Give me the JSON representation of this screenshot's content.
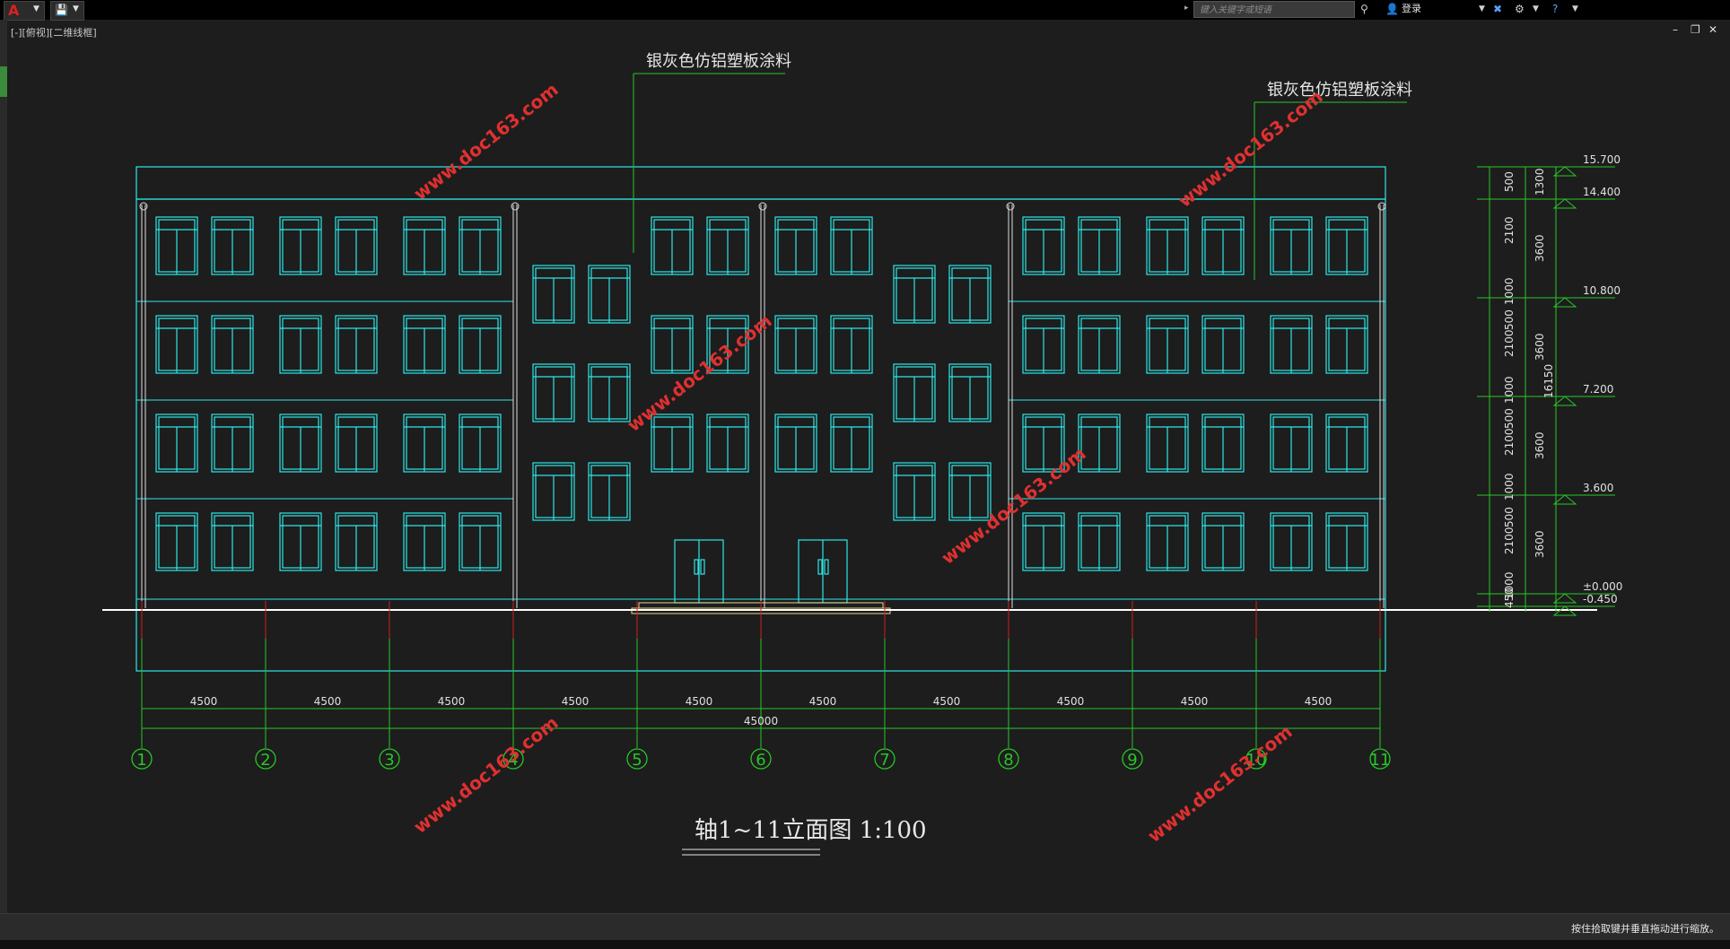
{
  "toolbar": {
    "app_menu_icon": "autocad-logo-icon",
    "search_placeholder": "键入关键字或短语",
    "login_label": "登录"
  },
  "viewport_label": "[-][俯视][二维线框]",
  "status_text": "按住拾取键并垂直拖动进行缩放。",
  "drawing": {
    "material_note_1": "银灰色仿铝塑板涂料",
    "material_note_2": "银灰色仿铝塑板涂料",
    "title": "轴1~11立面图 1:100",
    "axes": [
      "1",
      "2",
      "3",
      "4",
      "5",
      "6",
      "7",
      "8",
      "9",
      "10",
      "11"
    ],
    "bay_dimensions": [
      "4500",
      "4500",
      "4500",
      "4500",
      "4500",
      "4500",
      "4500",
      "4500",
      "4500",
      "4500"
    ],
    "total_dimension": "45000",
    "elevations": [
      "15.700",
      "14.400",
      "10.800",
      "7.200",
      "3.600",
      "±0.000",
      "-0.450"
    ],
    "vertical_dims_inner": [
      "500",
      "2100",
      "1000",
      "500",
      "2100",
      "1000",
      "500",
      "2100",
      "1000",
      "500",
      "2100",
      "1000",
      "450"
    ],
    "vertical_dims_mid": [
      "1300",
      "3600",
      "3600",
      "3600",
      "3600"
    ],
    "vertical_dim_total": "16150",
    "watermark": "www.doc163.com"
  }
}
